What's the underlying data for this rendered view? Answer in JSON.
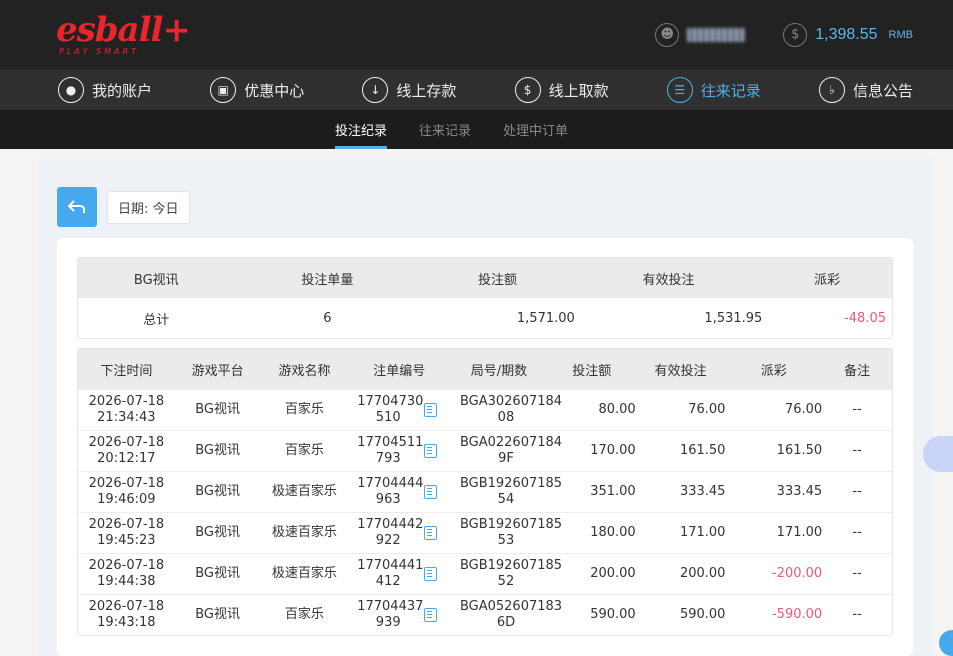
{
  "brand": {
    "logo_main": "esball+",
    "logo_sub": "PLAY SMART"
  },
  "account": {
    "balance": "1,398.55",
    "currency": "RMB"
  },
  "nav": [
    {
      "label": "我的账户",
      "icon": "user-icon"
    },
    {
      "label": "优惠中心",
      "icon": "gift-icon"
    },
    {
      "label": "线上存款",
      "icon": "deposit-icon"
    },
    {
      "label": "线上取款",
      "icon": "withdraw-icon"
    },
    {
      "label": "往来记录",
      "icon": "records-icon",
      "active": true
    },
    {
      "label": "信息公告",
      "icon": "bell-icon"
    }
  ],
  "subnav": [
    {
      "label": "投注纪录",
      "active": true
    },
    {
      "label": "往来记录"
    },
    {
      "label": "处理中订单"
    }
  ],
  "toolbar": {
    "date_label": "日期: 今日"
  },
  "summary": {
    "headers": [
      "BG视讯",
      "投注单量",
      "投注额",
      "有效投注",
      "派彩"
    ],
    "row": {
      "label": "总计",
      "count": "6",
      "bet": "1,571.00",
      "valid": "1,531.95",
      "payout": "-48.05"
    }
  },
  "detail": {
    "headers": [
      "下注时间",
      "游戏平台",
      "游戏名称",
      "注单编号",
      "局号/期数",
      "投注额",
      "有效投注",
      "派彩",
      "备注"
    ],
    "rows": [
      {
        "date": "2026-07-18",
        "time": "21:34:43",
        "platform": "BG视讯",
        "game": "百家乐",
        "ticket1": "17704730",
        "ticket2": "510",
        "round1": "BGA302607184",
        "round2": "08",
        "bet": "80.00",
        "valid": "76.00",
        "payout": "76.00",
        "note": "--"
      },
      {
        "date": "2026-07-18",
        "time": "20:12:17",
        "platform": "BG视讯",
        "game": "百家乐",
        "ticket1": "17704511",
        "ticket2": "793",
        "round1": "BGA022607184",
        "round2": "9F",
        "bet": "170.00",
        "valid": "161.50",
        "payout": "161.50",
        "note": "--"
      },
      {
        "date": "2026-07-18",
        "time": "19:46:09",
        "platform": "BG视讯",
        "game": "极速百家乐",
        "ticket1": "17704444",
        "ticket2": "963",
        "round1": "BGB192607185",
        "round2": "54",
        "bet": "351.00",
        "valid": "333.45",
        "payout": "333.45",
        "note": "--"
      },
      {
        "date": "2026-07-18",
        "time": "19:45:23",
        "platform": "BG视讯",
        "game": "极速百家乐",
        "ticket1": "17704442",
        "ticket2": "922",
        "round1": "BGB192607185",
        "round2": "53",
        "bet": "180.00",
        "valid": "171.00",
        "payout": "171.00",
        "note": "--"
      },
      {
        "date": "2026-07-18",
        "time": "19:44:38",
        "platform": "BG视讯",
        "game": "极速百家乐",
        "ticket1": "17704441",
        "ticket2": "412",
        "round1": "BGB192607185",
        "round2": "52",
        "bet": "200.00",
        "valid": "200.00",
        "payout": "-200.00",
        "note": "--",
        "negative": true
      },
      {
        "date": "2026-07-18",
        "time": "19:43:18",
        "platform": "BG视讯",
        "game": "百家乐",
        "ticket1": "17704437",
        "ticket2": "939",
        "round1": "BGA052607183",
        "round2": "6D",
        "bet": "590.00",
        "valid": "590.00",
        "payout": "-590.00",
        "note": "--",
        "negative": true
      }
    ]
  },
  "colors": {
    "accent": "#46a9ee",
    "brand_red": "#e8262b",
    "negative": "#e85a7a"
  }
}
